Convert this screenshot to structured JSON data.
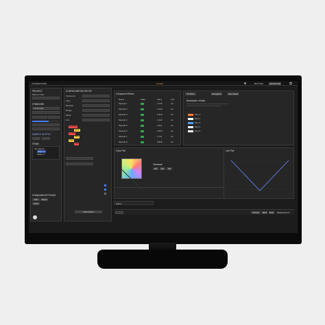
{
  "app": {
    "title": "CONNECTIONS",
    "center_title": "Parallel",
    "user_label": "BOTTOM",
    "tab_label": "Launch Test"
  },
  "left": {
    "section1": "PROJECT",
    "section1_value": "Plans to Test",
    "section2": "STANDARD",
    "field1": "Local Light",
    "sample_header": "SAMPLE OUTPUT",
    "tree_header": "ITEMS",
    "tree_items": [
      "Set objects",
      "Object 1",
      "Object 2"
    ],
    "bottom_header": "STANDARD SETTINGS",
    "bottom_btns": [
      "Edit",
      "Reset",
      "Save"
    ]
  },
  "config": {
    "title": "CONFIGURATION SETUP",
    "fields": [
      "Instrument",
      "Type",
      "Detector",
      "Range",
      "Mode",
      "Unit"
    ],
    "chips": [
      {
        "label": "Set Range",
        "color": "#ff4d4d"
      },
      {
        "label": "Adjust",
        "color": "#ffd23f"
      },
      {
        "label": "Set Ref",
        "color": "#ff4d4d"
      },
      {
        "label": "Offset",
        "color": "#ffd23f"
      },
      {
        "label": "Scale",
        "color": "#ffd23f"
      },
      {
        "label": "Hold",
        "color": "#ff4d4d"
      }
    ],
    "apply": "Start Setup"
  },
  "list": {
    "title": "Component Series",
    "headers": [
      "Name",
      "State",
      "Value",
      "Unit"
    ],
    "rows": [
      {
        "name": "Sample 1",
        "value": "2.145",
        "unit": "nm"
      },
      {
        "name": "Sample 2",
        "value": "2.240",
        "unit": "nm"
      },
      {
        "name": "Sample 3",
        "value": "2.318",
        "unit": "nm"
      },
      {
        "name": "Sample 4",
        "value": "2.402",
        "unit": "nm"
      },
      {
        "name": "Sample 5",
        "value": "2.511",
        "unit": "nm"
      },
      {
        "name": "Sample 6",
        "value": "2.620",
        "unit": "nm"
      },
      {
        "name": "Sample 7",
        "value": "2.711",
        "unit": "nm"
      },
      {
        "name": "Sample 8",
        "value": "2.825",
        "unit": "nm"
      }
    ]
  },
  "info": {
    "tab1": "All Plots",
    "tab2": "Navigation",
    "tab3": "Type Select",
    "heading": "Description of tests",
    "series": [
      {
        "name": "Item 1",
        "color": "#ff7a2f"
      },
      {
        "name": "Item 2",
        "color": "#ffffff"
      },
      {
        "name": "Item 3",
        "color": "#4da3ff"
      },
      {
        "name": "Item 4",
        "color": "#ffffff"
      },
      {
        "name": "Item 5",
        "color": "#ffffff"
      }
    ]
  },
  "plot": {
    "title": "Color Plot",
    "label": "Tolerance",
    "tags": [
      "Set",
      "Set",
      "Set"
    ]
  },
  "vplot": {
    "title": "Line Plot"
  },
  "bottom": {
    "field": "Status",
    "buttons": [
      "Cancel",
      "Back",
      "Next"
    ],
    "right": "Measurement"
  },
  "colors": {
    "screen": "#1c1c1c",
    "panel": "#262626",
    "accent": "#4a7dff",
    "green": "#2fa84f"
  }
}
